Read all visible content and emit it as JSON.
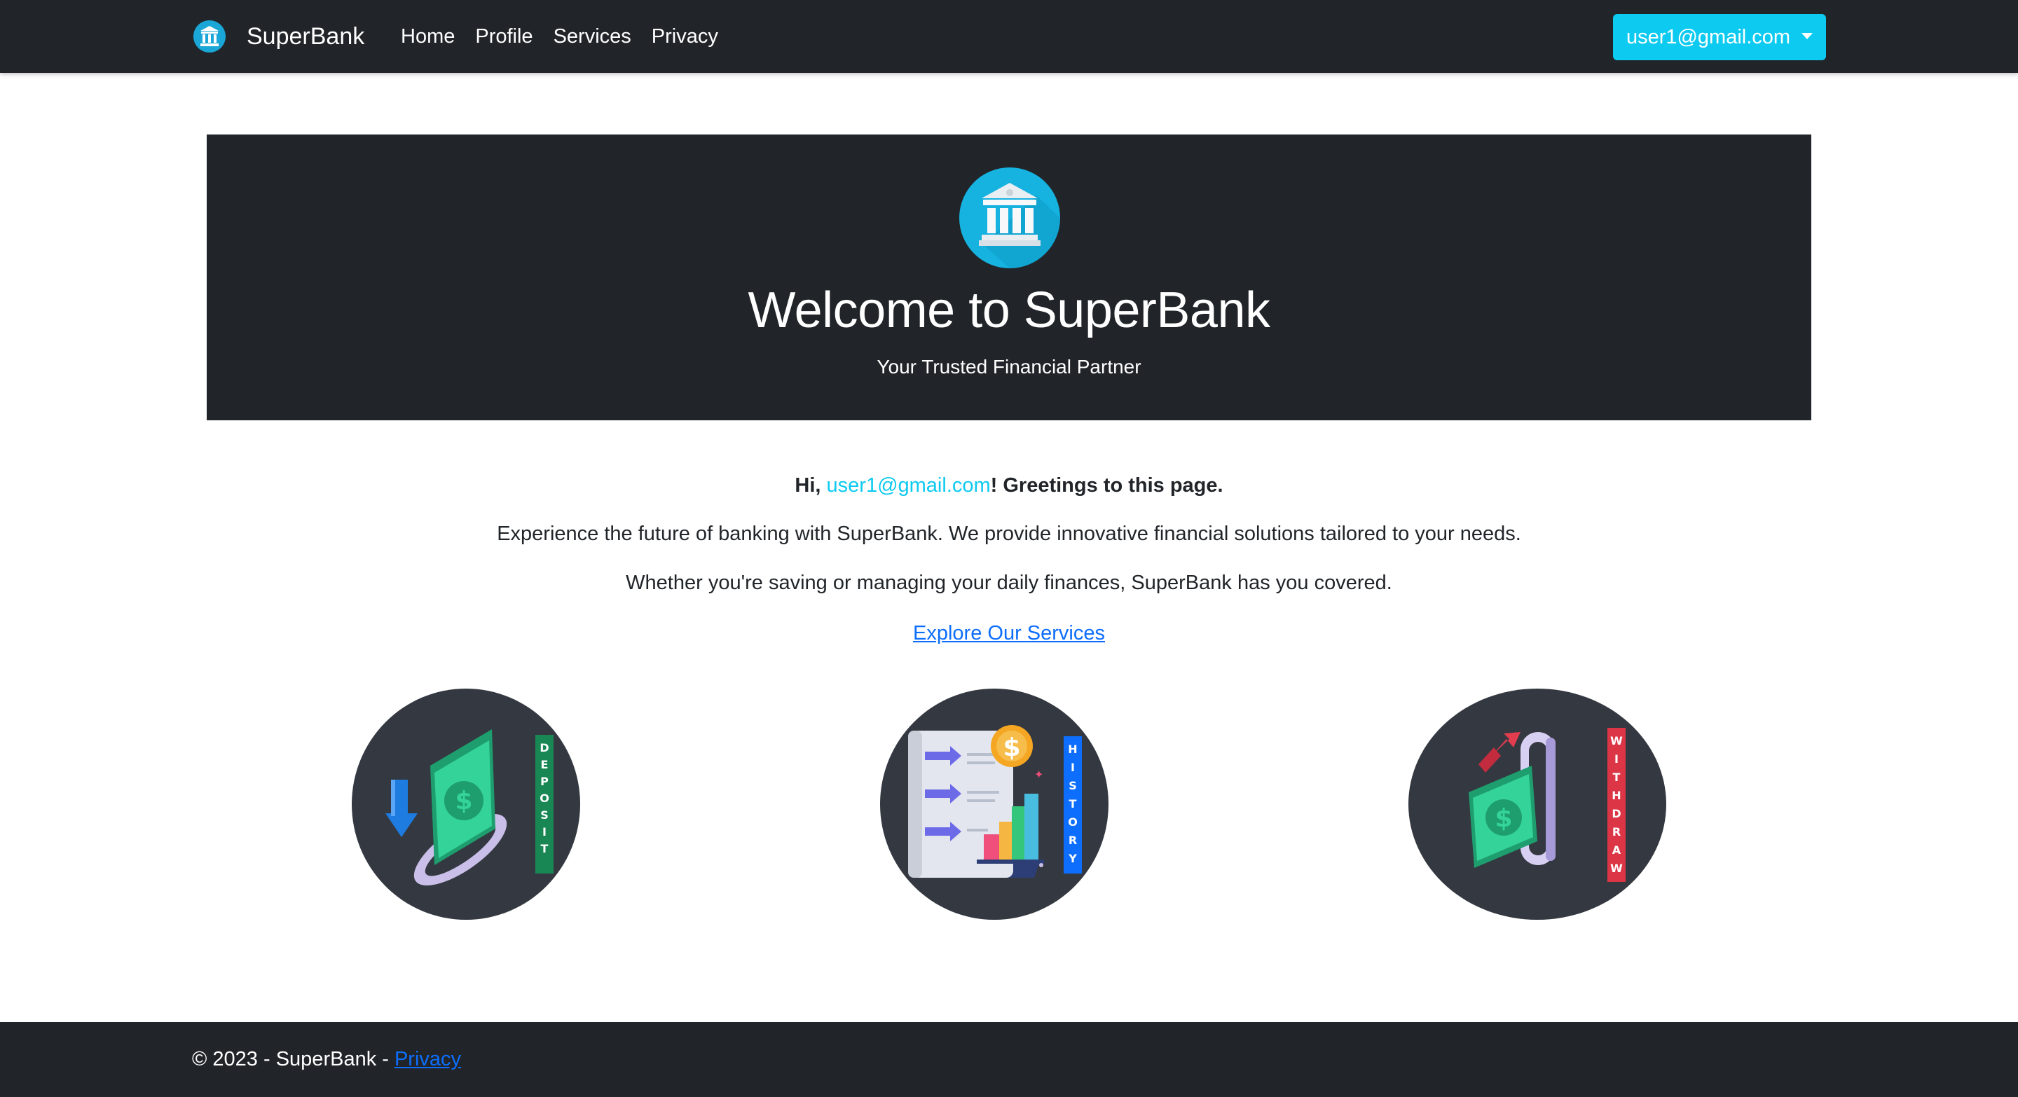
{
  "navbar": {
    "brand": "SuperBank",
    "brand_icon": "bank-icon",
    "links": [
      {
        "label": "Home"
      },
      {
        "label": "Profile"
      },
      {
        "label": "Services"
      },
      {
        "label": "Privacy"
      }
    ],
    "user_email": "user1@gmail.com"
  },
  "hero": {
    "icon": "bank-icon",
    "title": "Welcome to SuperBank",
    "subtitle": "Your Trusted Financial Partner"
  },
  "main": {
    "greeting_prefix": "Hi, ",
    "greeting_user": "user1@gmail.com",
    "greeting_suffix": "! Greetings to this page.",
    "intro": "Experience the future of banking with SuperBank. We provide innovative financial solutions tailored to your needs.",
    "intro2": "Whether you're saving or managing your daily finances, SuperBank has you covered.",
    "explore_link": "Explore Our Services"
  },
  "services": [
    {
      "label": "DEPOSIT",
      "icon": "deposit-icon",
      "label_color": "#198754"
    },
    {
      "label": "HISTORY",
      "icon": "history-icon",
      "label_color": "#0d6efd"
    },
    {
      "label": "WITHDRAW",
      "icon": "withdraw-icon",
      "label_color": "#dc3545"
    }
  ],
  "footer": {
    "text": "© 2023 - SuperBank - ",
    "privacy_link": "Privacy"
  },
  "colors": {
    "dark": "#212529",
    "accent": "#0dcaf0",
    "link": "#0d6efd"
  }
}
